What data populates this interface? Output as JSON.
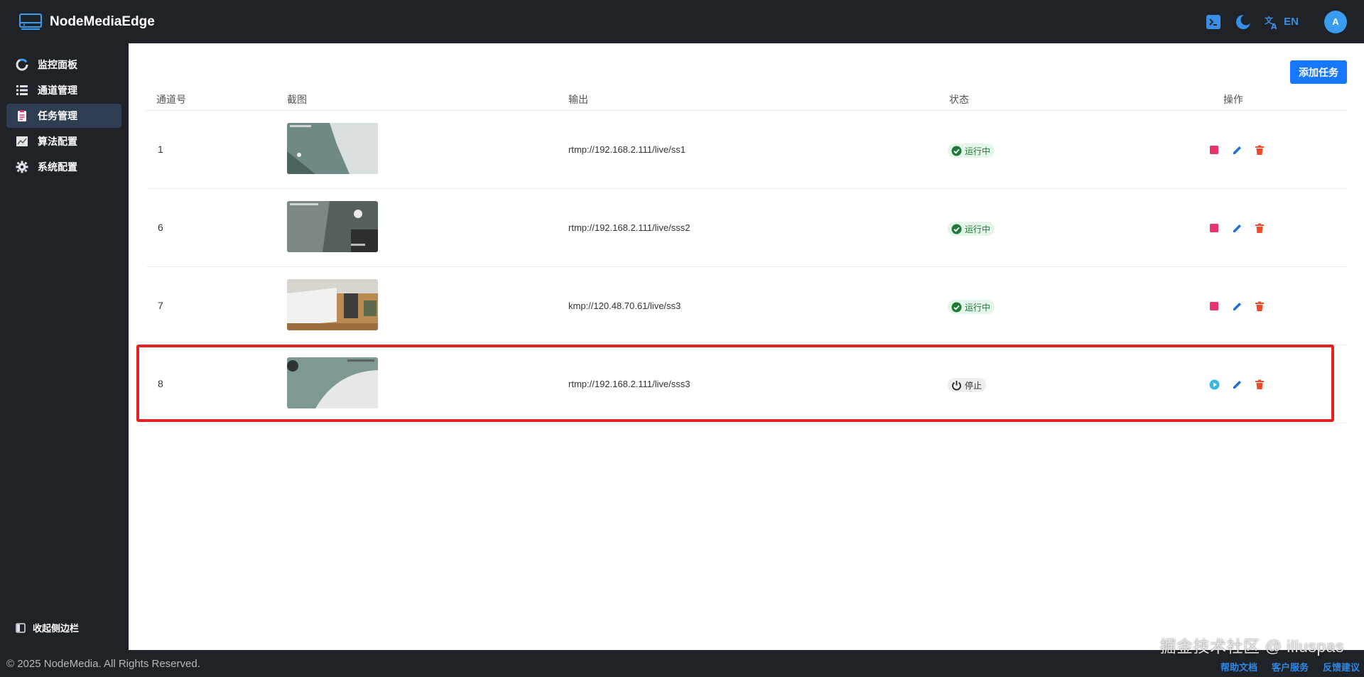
{
  "app": {
    "title": "NodeMediaEdge",
    "lang": "EN",
    "avatar_initial": "A",
    "colors": {
      "accent": "#1677ff",
      "dark": "#1f2227",
      "running": "#1f7a3a",
      "stop": "#e8336b",
      "delete": "#f04a2a"
    }
  },
  "topbar": {
    "icons": [
      "terminal-icon",
      "moon-icon",
      "translate-icon"
    ]
  },
  "sidebar": {
    "items": [
      {
        "label": "监控面板",
        "icon": "dashboard-icon",
        "active": false
      },
      {
        "label": "通道管理",
        "icon": "list-icon",
        "active": false
      },
      {
        "label": "任务管理",
        "icon": "clipboard-icon",
        "active": true
      },
      {
        "label": "算法配置",
        "icon": "chart-icon",
        "active": false
      },
      {
        "label": "系统配置",
        "icon": "gear-icon",
        "active": false
      }
    ],
    "collapse_label": "收起侧边栏"
  },
  "main": {
    "add_button": "添加任务",
    "columns": [
      "通道号",
      "截图",
      "输出",
      "状态",
      "操作"
    ],
    "rows": [
      {
        "channel": "1",
        "output": "rtmp://192.168.2.111/live/ss1",
        "status": "运行中",
        "running": true
      },
      {
        "channel": "6",
        "output": "rtmp://192.168.2.111/live/sss2",
        "status": "运行中",
        "running": true
      },
      {
        "channel": "7",
        "output": "kmp://120.48.70.61/live/ss3",
        "status": "运行中",
        "running": true
      },
      {
        "channel": "8",
        "output": "rtmp://192.168.2.111/live/sss3",
        "status": "停止",
        "running": false
      }
    ]
  },
  "footer": {
    "copyright": "© 2025 NodeMedia. All Rights Reserved.",
    "watermark": "掘金技术社区 @ illuspas",
    "links": [
      "帮助文档",
      "客户服务",
      "反馈建议"
    ]
  }
}
